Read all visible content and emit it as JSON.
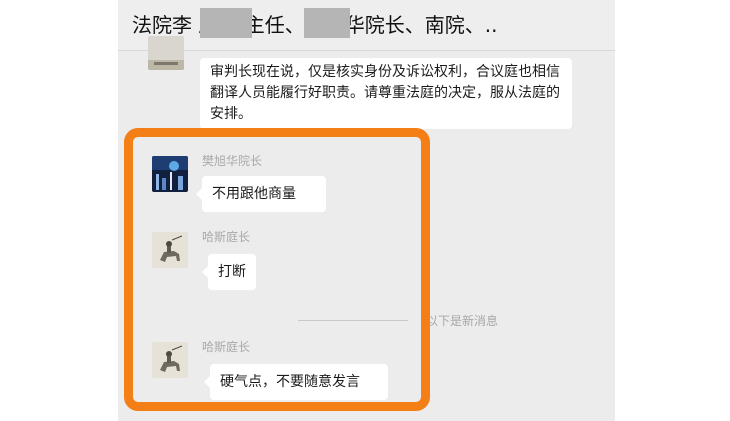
{
  "header": {
    "title": "法院李       局、      主任、樊旭华院长、南院、.."
  },
  "messages": [
    {
      "text": "审判长现在说，仅是核实身份及诉讼权利，合议庭也相信翻译人员能履行好职责。请尊重法庭的决定，服从法庭的安排。"
    },
    {
      "sender": "樊旭华院长",
      "text": "不用跟他商量",
      "avatar_icon": "night-city-photo-avatar"
    },
    {
      "sender": "哈斯庭长",
      "text": "打断",
      "avatar_icon": "horse-rider-avatar"
    },
    {
      "sender": "哈斯庭长",
      "text": "硬气点，不要随意发言",
      "avatar_icon": "horse-rider-avatar"
    }
  ],
  "divider": {
    "text": "以下是新消息"
  },
  "colors": {
    "highlight": "#f57f17",
    "chat_background": "#ececec",
    "bubble": "#ffffff"
  }
}
